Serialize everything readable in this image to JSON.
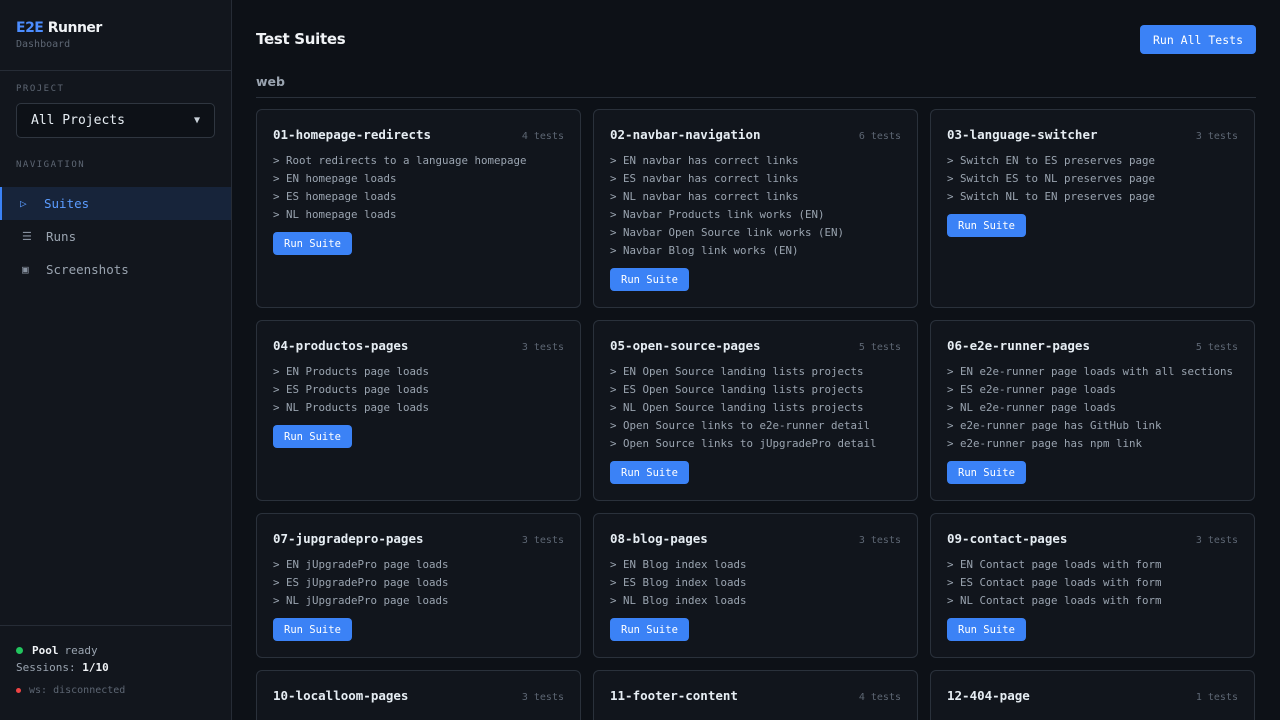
{
  "brand": {
    "prefix": "E2E",
    "suffix": " Runner",
    "subtitle": "Dashboard"
  },
  "sidebar": {
    "project_label": "PROJECT",
    "project_value": "All Projects",
    "nav_label": "NAVIGATION",
    "items": [
      {
        "label": "Suites",
        "icon": "play-icon",
        "glyph": "▷"
      },
      {
        "label": "Runs",
        "icon": "list-icon",
        "glyph": "☰"
      },
      {
        "label": "Screenshots",
        "icon": "image-icon",
        "glyph": "▣"
      }
    ],
    "active_item": "Suites"
  },
  "pool": {
    "name": "Pool",
    "status": "ready",
    "sessions_label": "Sessions:",
    "sessions_value": "1/10",
    "ws": "ws: disconnected"
  },
  "main": {
    "title": "Test Suites",
    "run_all_label": "Run All Tests",
    "group": "web"
  },
  "run_suite_label": "Run Suite",
  "suites": [
    {
      "name": "01-homepage-redirects",
      "count": "4 tests",
      "tests": [
        "Root redirects to a language homepage",
        "EN homepage loads",
        "ES homepage loads",
        "NL homepage loads"
      ]
    },
    {
      "name": "02-navbar-navigation",
      "count": "6 tests",
      "tests": [
        "EN navbar has correct links",
        "ES navbar has correct links",
        "NL navbar has correct links",
        "Navbar Products link works (EN)",
        "Navbar Open Source link works (EN)",
        "Navbar Blog link works (EN)"
      ]
    },
    {
      "name": "03-language-switcher",
      "count": "3 tests",
      "tests": [
        "Switch EN to ES preserves page",
        "Switch ES to NL preserves page",
        "Switch NL to EN preserves page"
      ]
    },
    {
      "name": "04-productos-pages",
      "count": "3 tests",
      "tests": [
        "EN Products page loads",
        "ES Products page loads",
        "NL Products page loads"
      ]
    },
    {
      "name": "05-open-source-pages",
      "count": "5 tests",
      "tests": [
        "EN Open Source landing lists projects",
        "ES Open Source landing lists projects",
        "NL Open Source landing lists projects",
        "Open Source links to e2e-runner detail",
        "Open Source links to jUpgradePro detail"
      ]
    },
    {
      "name": "06-e2e-runner-pages",
      "count": "5 tests",
      "tests": [
        "EN e2e-runner page loads with all sections",
        "ES e2e-runner page loads",
        "NL e2e-runner page loads",
        "e2e-runner page has GitHub link",
        "e2e-runner page has npm link"
      ]
    },
    {
      "name": "07-jupgradepro-pages",
      "count": "3 tests",
      "tests": [
        "EN jUpgradePro page loads",
        "ES jUpgradePro page loads",
        "NL jUpgradePro page loads"
      ]
    },
    {
      "name": "08-blog-pages",
      "count": "3 tests",
      "tests": [
        "EN Blog index loads",
        "ES Blog index loads",
        "NL Blog index loads"
      ]
    },
    {
      "name": "09-contact-pages",
      "count": "3 tests",
      "tests": [
        "EN Contact page loads with form",
        "ES Contact page loads with form",
        "NL Contact page loads with form"
      ]
    },
    {
      "name": "10-localloom-pages",
      "count": "3 tests",
      "tests": []
    },
    {
      "name": "11-footer-content",
      "count": "4 tests",
      "tests": []
    },
    {
      "name": "12-404-page",
      "count": "1 tests",
      "tests": []
    }
  ],
  "colors": {
    "accent": "#3b82f6",
    "ready": "#22c55e",
    "disconnected": "#ef4444",
    "background": "#0d1117"
  }
}
